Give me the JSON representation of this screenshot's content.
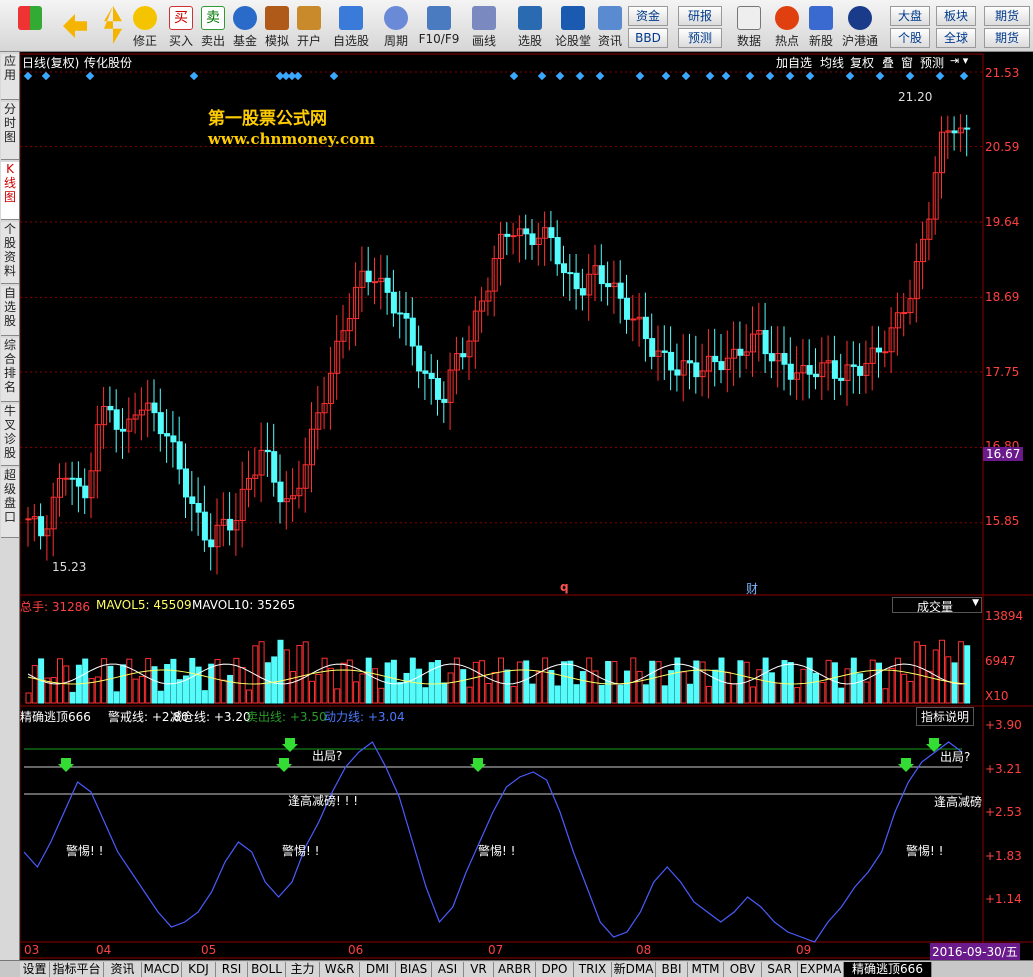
{
  "toolbar": {
    "buttons": [
      {
        "label": ""
      },
      {
        "label": ""
      },
      {
        "label": "修正"
      },
      {
        "label": "买入"
      },
      {
        "label": "卖出"
      },
      {
        "label": "基金"
      },
      {
        "label": "模拟"
      },
      {
        "label": "开户"
      },
      {
        "label": "自选股"
      },
      {
        "label": "周期"
      },
      {
        "label": "F10/F9"
      },
      {
        "label": "画线"
      },
      {
        "label": "选股"
      },
      {
        "label": "论股堂"
      },
      {
        "label": "资讯"
      },
      {
        "label": "数据"
      },
      {
        "label": "热点"
      },
      {
        "label": "新股"
      },
      {
        "label": "沪港通"
      }
    ],
    "small_buttons": [
      "资金",
      "BBD",
      "研报",
      "预测",
      "大盘",
      "个股",
      "板块",
      "全球",
      "期货",
      "期货"
    ]
  },
  "side_tabs": [
    "应用",
    "分时图",
    "K线图",
    "个股资料",
    "自选股",
    "综合排名",
    "牛叉诊股",
    "超级盘口"
  ],
  "chart_header": {
    "period": "日线(复权)",
    "stock": "传化股份"
  },
  "chart_buttons": [
    "加自选",
    "均线",
    "复权",
    "叠",
    "窗",
    "预测"
  ],
  "watermark": {
    "title": "第一股票公式网",
    "url": "www.chnmoney.com"
  },
  "price_axis": [
    "21.53",
    "20.59",
    "19.64",
    "18.69",
    "17.75",
    "16.80",
    "15.85"
  ],
  "current_price": "16.67",
  "high_label": "21.20",
  "low_label": "15.23",
  "event_markers": [
    "q",
    "财"
  ],
  "volume": {
    "label_total": "总手: 31286",
    "label_mavol5": "MAVOL5: 45509",
    "label_mavol10": "MAVOL10: 35265",
    "selector": "成交量",
    "axis": [
      "13894",
      "6947"
    ],
    "unit": "X10"
  },
  "indicator": {
    "name": "精确逃顶666",
    "warn": "警戒线: +2.80",
    "reduce": "减仓线: +3.20",
    "sell": "卖出线: +3.50",
    "power": "动力线: +3.04",
    "help": "指标说明",
    "axis": [
      "+3.90",
      "+3.21",
      "+2.53",
      "+1.83",
      "+1.14"
    ],
    "annotations": [
      "出局?",
      "逢高减磅! ! !",
      "警惕! !",
      "出局?",
      "逢高减磅",
      "警惕! !",
      "警惕! !",
      "警惕! !"
    ]
  },
  "months": [
    "03",
    "04",
    "05",
    "06",
    "07",
    "08",
    "09"
  ],
  "date_label": "2016-09-30/五",
  "bottom_tabs": [
    "设置",
    "指标平台",
    "资讯",
    "MACD",
    "KDJ",
    "RSI",
    "BOLL",
    "主力",
    "W&R",
    "DMI",
    "BIAS",
    "ASI",
    "VR",
    "ARBR",
    "DPO",
    "TRIX",
    "新DMA",
    "BBI",
    "MTM",
    "OBV",
    "SAR",
    "EXPMA",
    "精确逃顶666"
  ],
  "colors": {
    "up": "#ff3030",
    "down": "#54fcfc",
    "grid": "#8b0000",
    "power_line": "#4a5cff"
  }
}
